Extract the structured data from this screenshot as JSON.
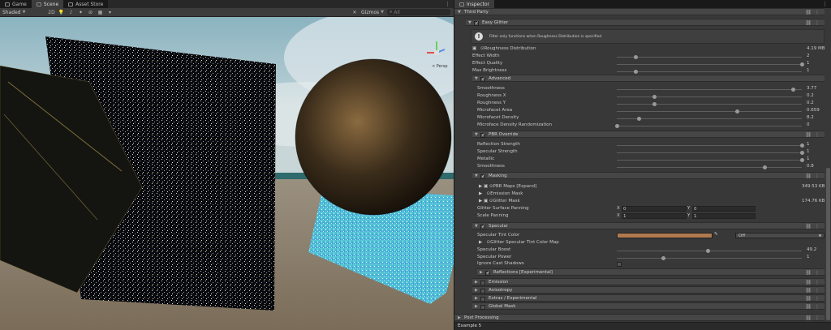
{
  "scene_tabs": [
    {
      "label": "Game",
      "icon": "game-controller-icon"
    },
    {
      "label": "Scene",
      "icon": "scene-icon"
    },
    {
      "label": "Asset Store",
      "icon": "store-icon"
    }
  ],
  "toolbar": {
    "shading_mode": "Shaded",
    "dimension": "2D",
    "gizmos_label": "Gizmos",
    "search_placeholder": "All",
    "view_label": "< Persp"
  },
  "inspector": {
    "tab_label": "Inspector",
    "third_party_label": "Third Party",
    "easy_glitter_label": "Easy Glitter",
    "warning_text": "Filter only functions when Roughness Distribution is specified.",
    "roughness_distribution_label": "Roughness Distribution",
    "roughness_distribution_value": "4.19 MB",
    "effect_width_label": "Effect Width",
    "effect_width_value": "2",
    "effect_quality_label": "Effect Quality",
    "effect_quality_value": "1",
    "max_brightness_label": "Max Brightness",
    "max_brightness_value": "1",
    "advanced_label": "Advanced",
    "smoothness_label": "Smoothness",
    "smoothness_value": "3.77",
    "roughness_x_label": "Roughness X",
    "roughness_x_value": "0.2",
    "roughness_y_label": "Roughness Y",
    "roughness_y_value": "0.2",
    "microfacet_area_label": "Microfacet Area",
    "microfacet_area_value": "0.659",
    "microfacet_density_label": "Microfacet Density",
    "microfacet_density_value": "8.2",
    "microface_rand_label": "Microface Density Randomization",
    "microface_rand_value": "0",
    "pbr_override_label": "PBR Override",
    "reflection_strength_label": "Reflection Strength",
    "reflection_strength_value": "1",
    "specular_strength_label": "Specular Strength",
    "specular_strength_value": "1",
    "metallic_label": "Metallic",
    "metallic_value": "1",
    "pbr_smoothness_label": "Smoothness",
    "pbr_smoothness_value": "0.8",
    "masking_label": "Masking",
    "pbr_maps_label": "PBR Maps [Expand]",
    "pbr_maps_value": "349.53 KB",
    "emission_mask_label": "Emission Mask",
    "glitter_mask_label": "Glitter Mask",
    "glitter_mask_value": "174.76 KB",
    "glitter_panning_label": "Glitter Surface Panning",
    "glitter_panning_x": "0",
    "glitter_panning_y": "0",
    "scale_panning_label": "Scale Panning",
    "scale_panning_x": "1",
    "scale_panning_y": "1",
    "specular_label": "Specular",
    "specular_tint_label": "Specular Tint Color",
    "specular_tint_color": "#b07a4e",
    "specular_tint_mode": "Off",
    "specular_tint_map_label": "Glitter Specular Tint Color Map",
    "specular_boost_label": "Specular Boost",
    "specular_boost_value": "49.2",
    "specular_power_label": "Specular Power",
    "specular_power_value": "1",
    "ignore_cast_label": "Ignore Cast Shadows",
    "reflections_label": "Reflections [Experimental]",
    "emission_label": "Emission",
    "anisotropy_label": "Anisotropy",
    "extras_label": "Extras / Experimental",
    "global_mask_label": "Global Mask",
    "post_processing_label": "Post Processing",
    "footer_label": "Example 5",
    "axis_x_label": "X",
    "axis_y_label": "Y"
  },
  "sliders": {
    "effect_width": 0.1,
    "effect_quality": 1.0,
    "max_brightness": 0.1,
    "smoothness": 0.95,
    "roughness_x": 0.2,
    "roughness_y": 0.2,
    "microfacet_area": 0.65,
    "microfacet_density": 0.12,
    "microface_rand": 0.0,
    "reflection_strength": 1.0,
    "specular_strength": 1.0,
    "metallic": 1.0,
    "pbr_smoothness": 0.8,
    "specular_boost": 0.49,
    "specular_power": 0.25
  },
  "colors": {
    "accent": "#3a72b0",
    "panel": "#383838",
    "header": "#464646"
  }
}
